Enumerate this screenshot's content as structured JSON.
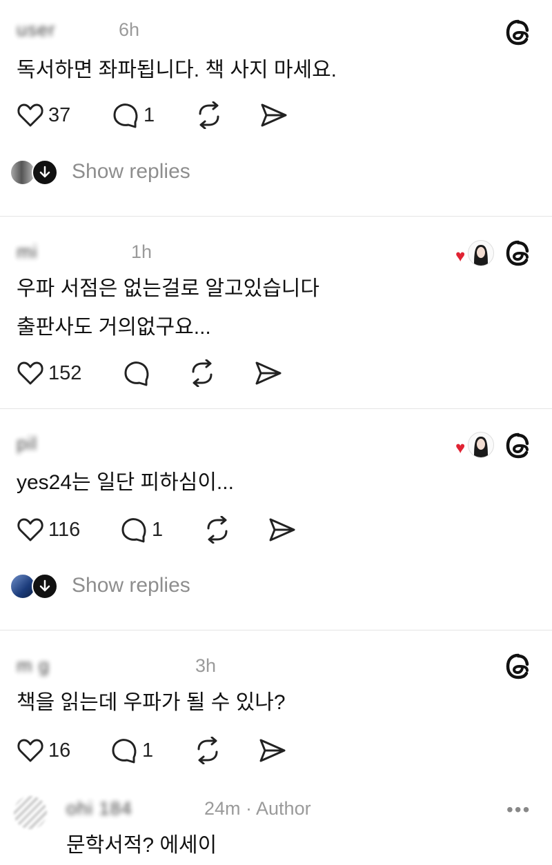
{
  "threads": [
    {
      "username": "user6h",
      "time": "6h",
      "content": [
        "독서하면 좌파됩니다. 책 사지 마세요."
      ],
      "likes": "37",
      "replies": "1",
      "show_replies": "Show replies",
      "liked_by_author": false
    },
    {
      "username": "mi",
      "time": "1h",
      "content": [
        "우파 서점은 없는걸로 알고있습니다",
        "출판사도 거의없구요..."
      ],
      "likes": "152",
      "replies": "",
      "show_replies": "",
      "liked_by_author": true
    },
    {
      "username": "p",
      "time": "",
      "content": [
        "yes24는 일단 피하심이..."
      ],
      "likes": "116",
      "replies": "1",
      "show_replies": "Show replies",
      "liked_by_author": true
    },
    {
      "username": "m",
      "time": "3h",
      "content": [
        "책을 읽는데 우파가 될 수 있나?"
      ],
      "likes": "16",
      "replies": "1",
      "show_replies": "",
      "liked_by_author": false
    },
    {
      "username": "184",
      "time": "24m · Author",
      "content": [
        "문학서적? 에세이"
      ],
      "likes": "",
      "replies": "",
      "show_replies": "",
      "liked_by_author": false
    }
  ],
  "more_label": "•••",
  "colors": {
    "like_red": "#e02333",
    "muted": "#8e8e8e"
  },
  "icons": [
    "threads-logo-icon",
    "heart-icon",
    "comment-icon",
    "repost-icon",
    "share-icon",
    "arrow-down-icon"
  ]
}
